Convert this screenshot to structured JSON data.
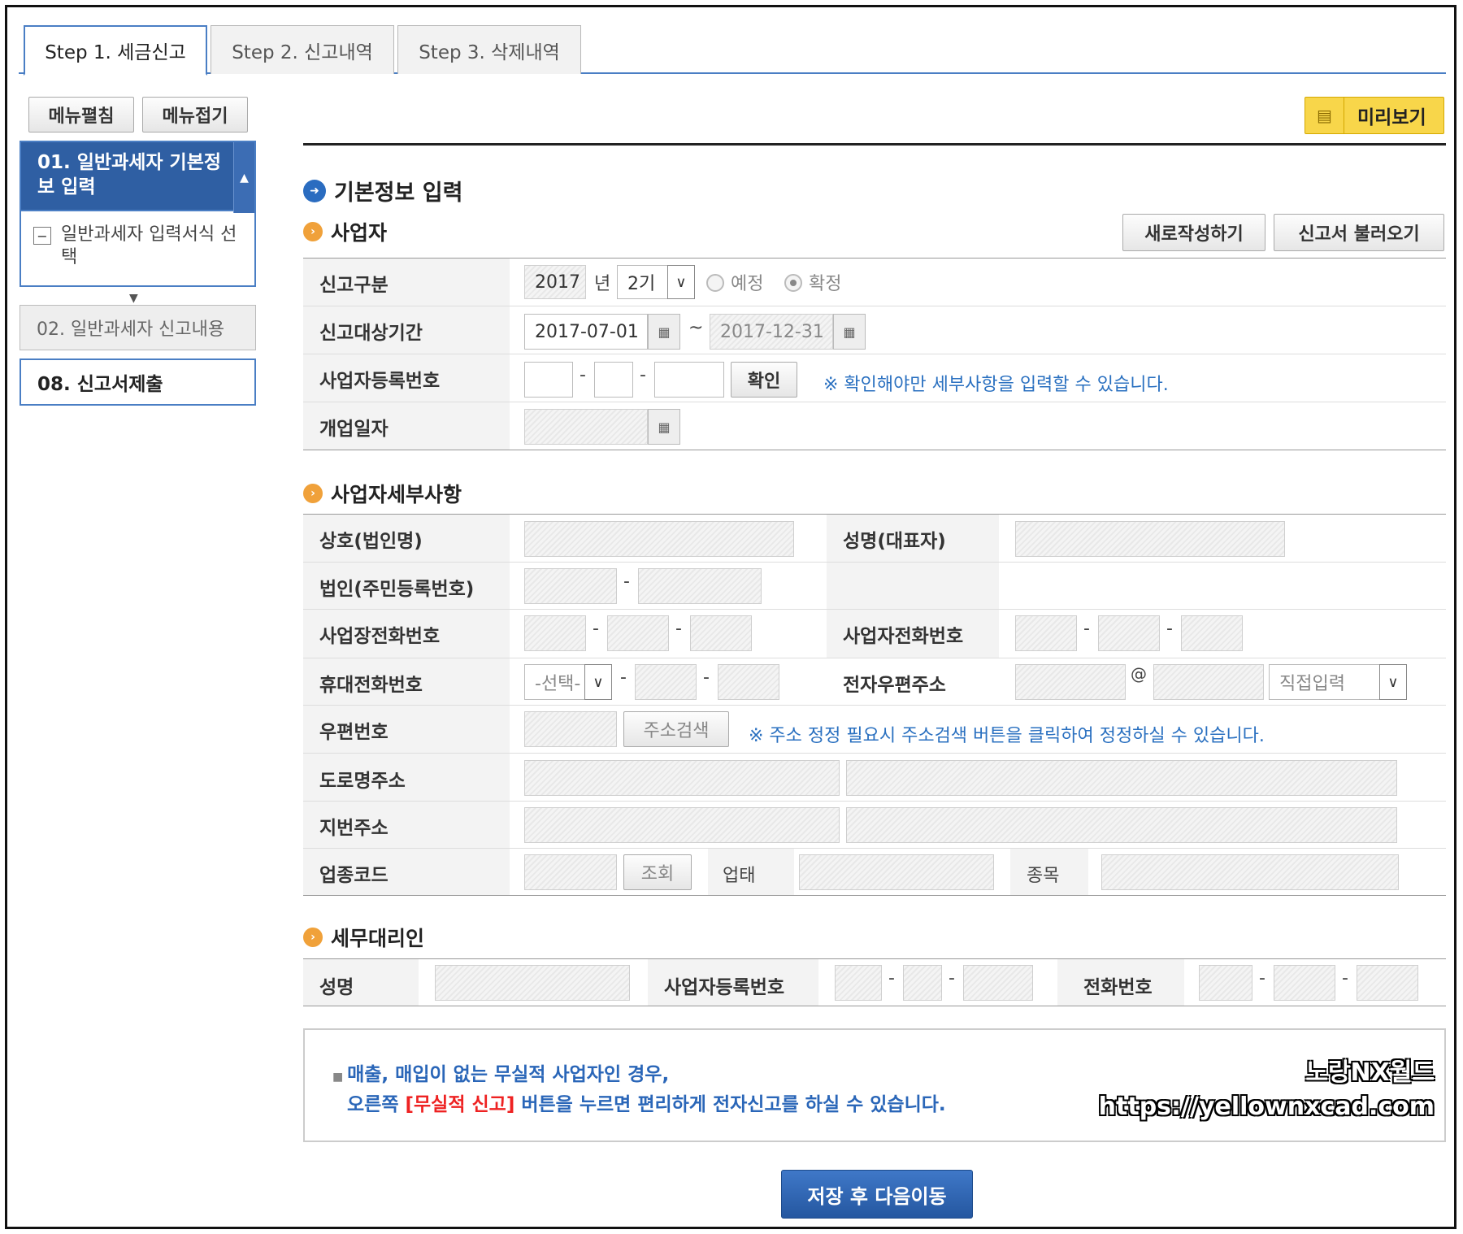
{
  "tabs": [
    "Step 1. 세금신고",
    "Step 2. 신고내역",
    "Step 3. 삭제내역"
  ],
  "sidebar": {
    "expand_label": "메뉴펼침",
    "collapse_label": "메뉴접기",
    "item1_title": "01. 일반과세자 기본정보 입력",
    "item1_sub": "일반과세자 입력서식 선택",
    "item2": "02. 일반과세자 신고내용",
    "item3": "08. 신고서제출"
  },
  "toolbar": {
    "preview_label": "미리보기"
  },
  "main": {
    "title": "기본정보 입력",
    "section1": "사업자",
    "new_label": "새로작성하기",
    "load_label": "신고서 불러오기",
    "labels": {
      "report_type": "신고구분",
      "period": "신고대상기간",
      "biz_no": "사업자등록번호",
      "open_date": "개업일자"
    },
    "year": "2017",
    "year_unit": "년",
    "term": "2기",
    "radio_pre": "예정",
    "radio_final": "확정",
    "date_from": "2017-07-01",
    "date_sep": "~",
    "date_to": "2017-12-31",
    "confirm_label": "확인",
    "confirm_note": "※ 확인해야만 세부사항을 입력할 수 있습니다.",
    "section2": "사업자세부사항",
    "labels2": {
      "company": "상호(법인명)",
      "rep": "성명(대표자)",
      "corp_no": "법인(주민등록번호)",
      "biz_phone": "사업장전화번호",
      "owner_phone": "사업자전화번호",
      "mobile": "휴대전화번호",
      "email": "전자우편주소",
      "zip": "우편번호",
      "road": "도로명주소",
      "lot": "지번주소",
      "industry": "업종코드",
      "type": "업태",
      "item": "종목"
    },
    "mobile_select": "-선택-",
    "at": "@",
    "email_select": "직접입력",
    "addr_search": "주소검색",
    "addr_note": "※ 주소 정정 필요시 주소검색 버튼을 클릭하여 정정하실 수 있습니다.",
    "lookup": "조회",
    "section3": "세무대리인",
    "labels3": {
      "name": "성명",
      "biz_no": "사업자등록번호",
      "phone": "전화번호"
    },
    "notice_line1": "매출, 매입이 없는 무실적 사업자인 경우,",
    "notice_line2a": "오른쪽 ",
    "notice_line2b": "[무실적 신고]",
    "notice_line2c": " 버튼을 누르면 편리하게 전자신고를 하실 수 있습니다.",
    "save_label": "저장 후 다음이동"
  },
  "watermark": {
    "line1": "노랑NX월드",
    "line2": "https://yellownxcad.com"
  }
}
